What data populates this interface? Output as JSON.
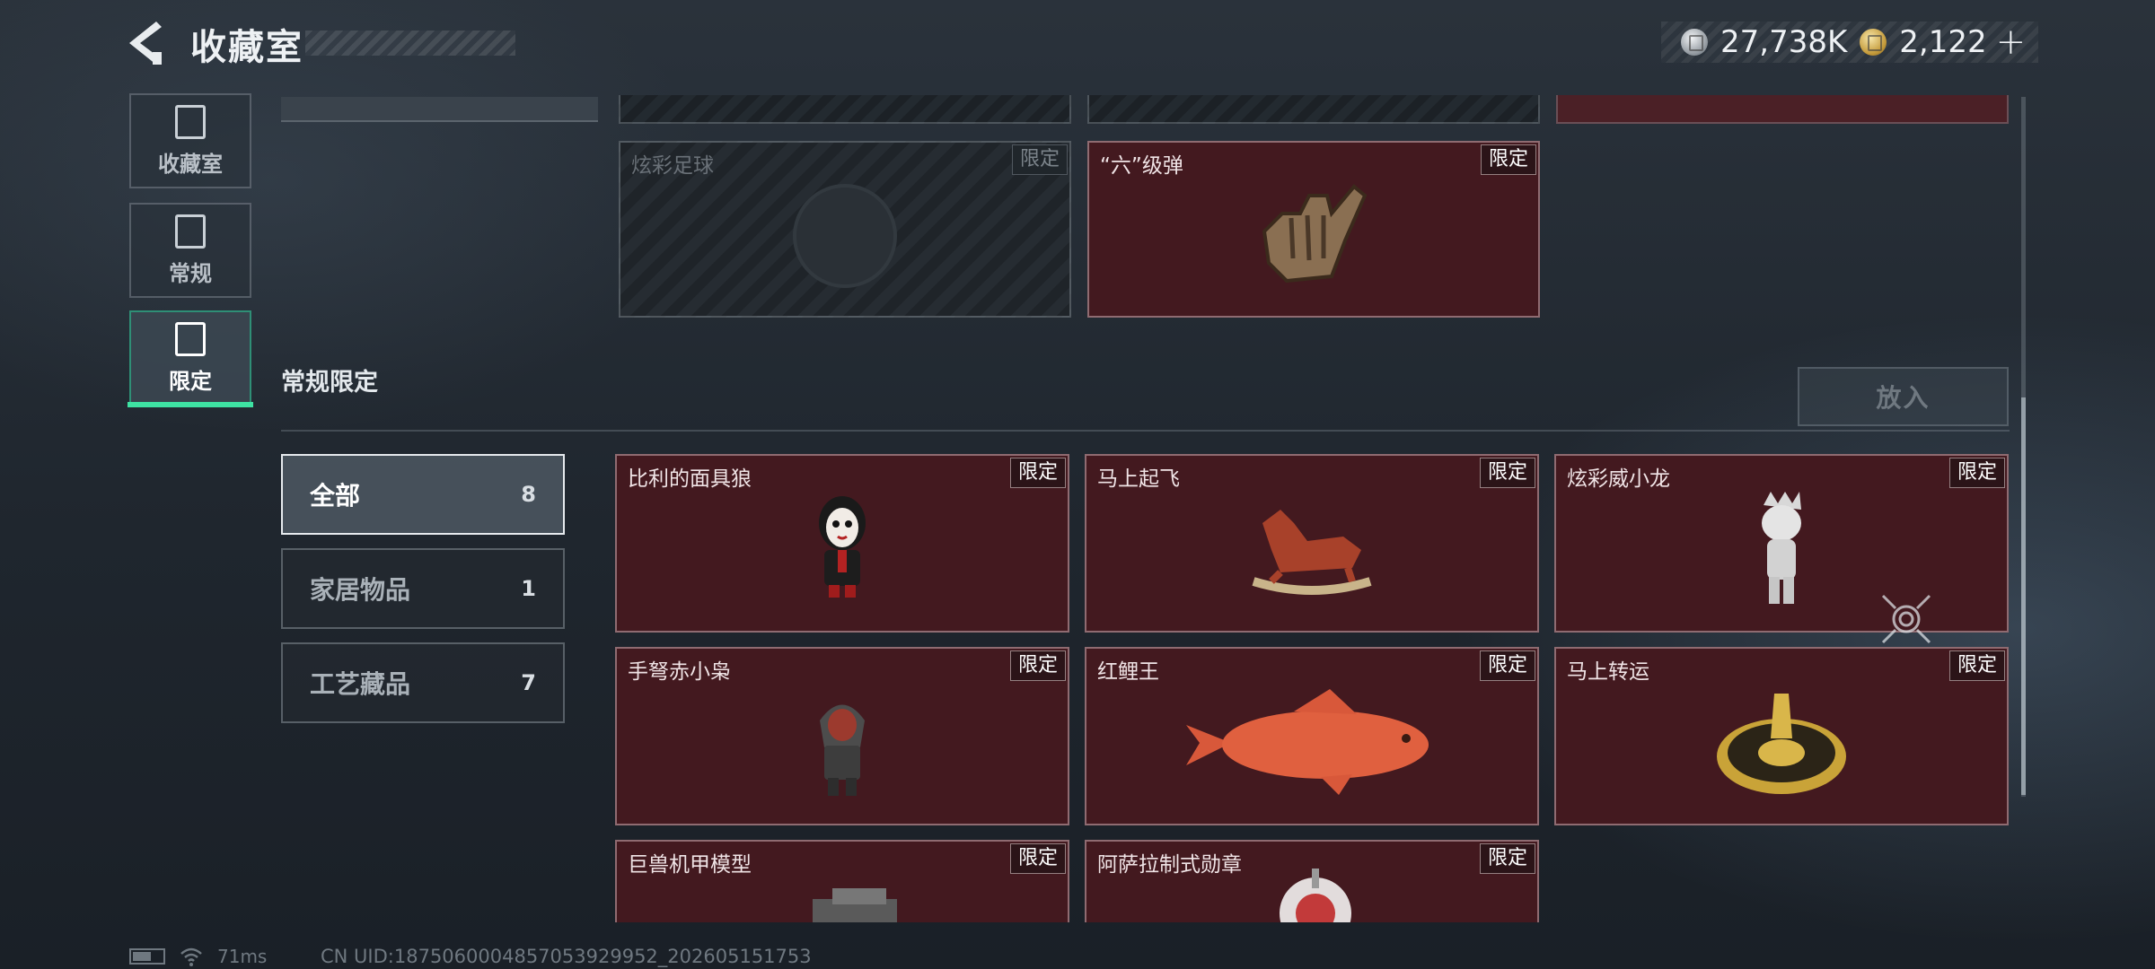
{
  "header": {
    "title": "收藏室",
    "currencies": [
      {
        "icon": "silver-coin-icon",
        "value": "27,738K"
      },
      {
        "icon": "gold-coin-icon",
        "value": "2,122",
        "add_label": "+"
      }
    ]
  },
  "nav": {
    "items": [
      {
        "label": "收藏室",
        "icon": "collection-room-icon"
      },
      {
        "label": "常规",
        "icon": "regular-icon"
      },
      {
        "label": "限定",
        "icon": "limited-icon",
        "active": true
      }
    ]
  },
  "upper_cards": [
    {
      "name": "炫彩足球",
      "tag": "限定",
      "locked": true
    },
    {
      "name": "“六”级弹",
      "tag": "限定",
      "locked": false
    }
  ],
  "section": {
    "title": "常规限定",
    "put_in_label": "放入"
  },
  "filters": [
    {
      "label": "全部",
      "count": "8",
      "active": true
    },
    {
      "label": "家居物品",
      "count": "1"
    },
    {
      "label": "工艺藏品",
      "count": "7"
    }
  ],
  "items": [
    {
      "name": "比利的面具狼",
      "tag": "限定"
    },
    {
      "name": "马上起飞",
      "tag": "限定"
    },
    {
      "name": "炫彩威小龙",
      "tag": "限定"
    },
    {
      "name": "手弩赤小枭",
      "tag": "限定"
    },
    {
      "name": "红鲤王",
      "tag": "限定"
    },
    {
      "name": "马上转运",
      "tag": "限定"
    },
    {
      "name": "巨兽机甲模型",
      "tag": "限定"
    },
    {
      "name": "阿萨拉制式勋章",
      "tag": "限定"
    }
  ],
  "status": {
    "ping": "71ms",
    "uid": "CN UID:18750600048570539299​52_202605151753"
  },
  "colors": {
    "accent": "#3ee3a3",
    "card_bg": "#43191f"
  }
}
